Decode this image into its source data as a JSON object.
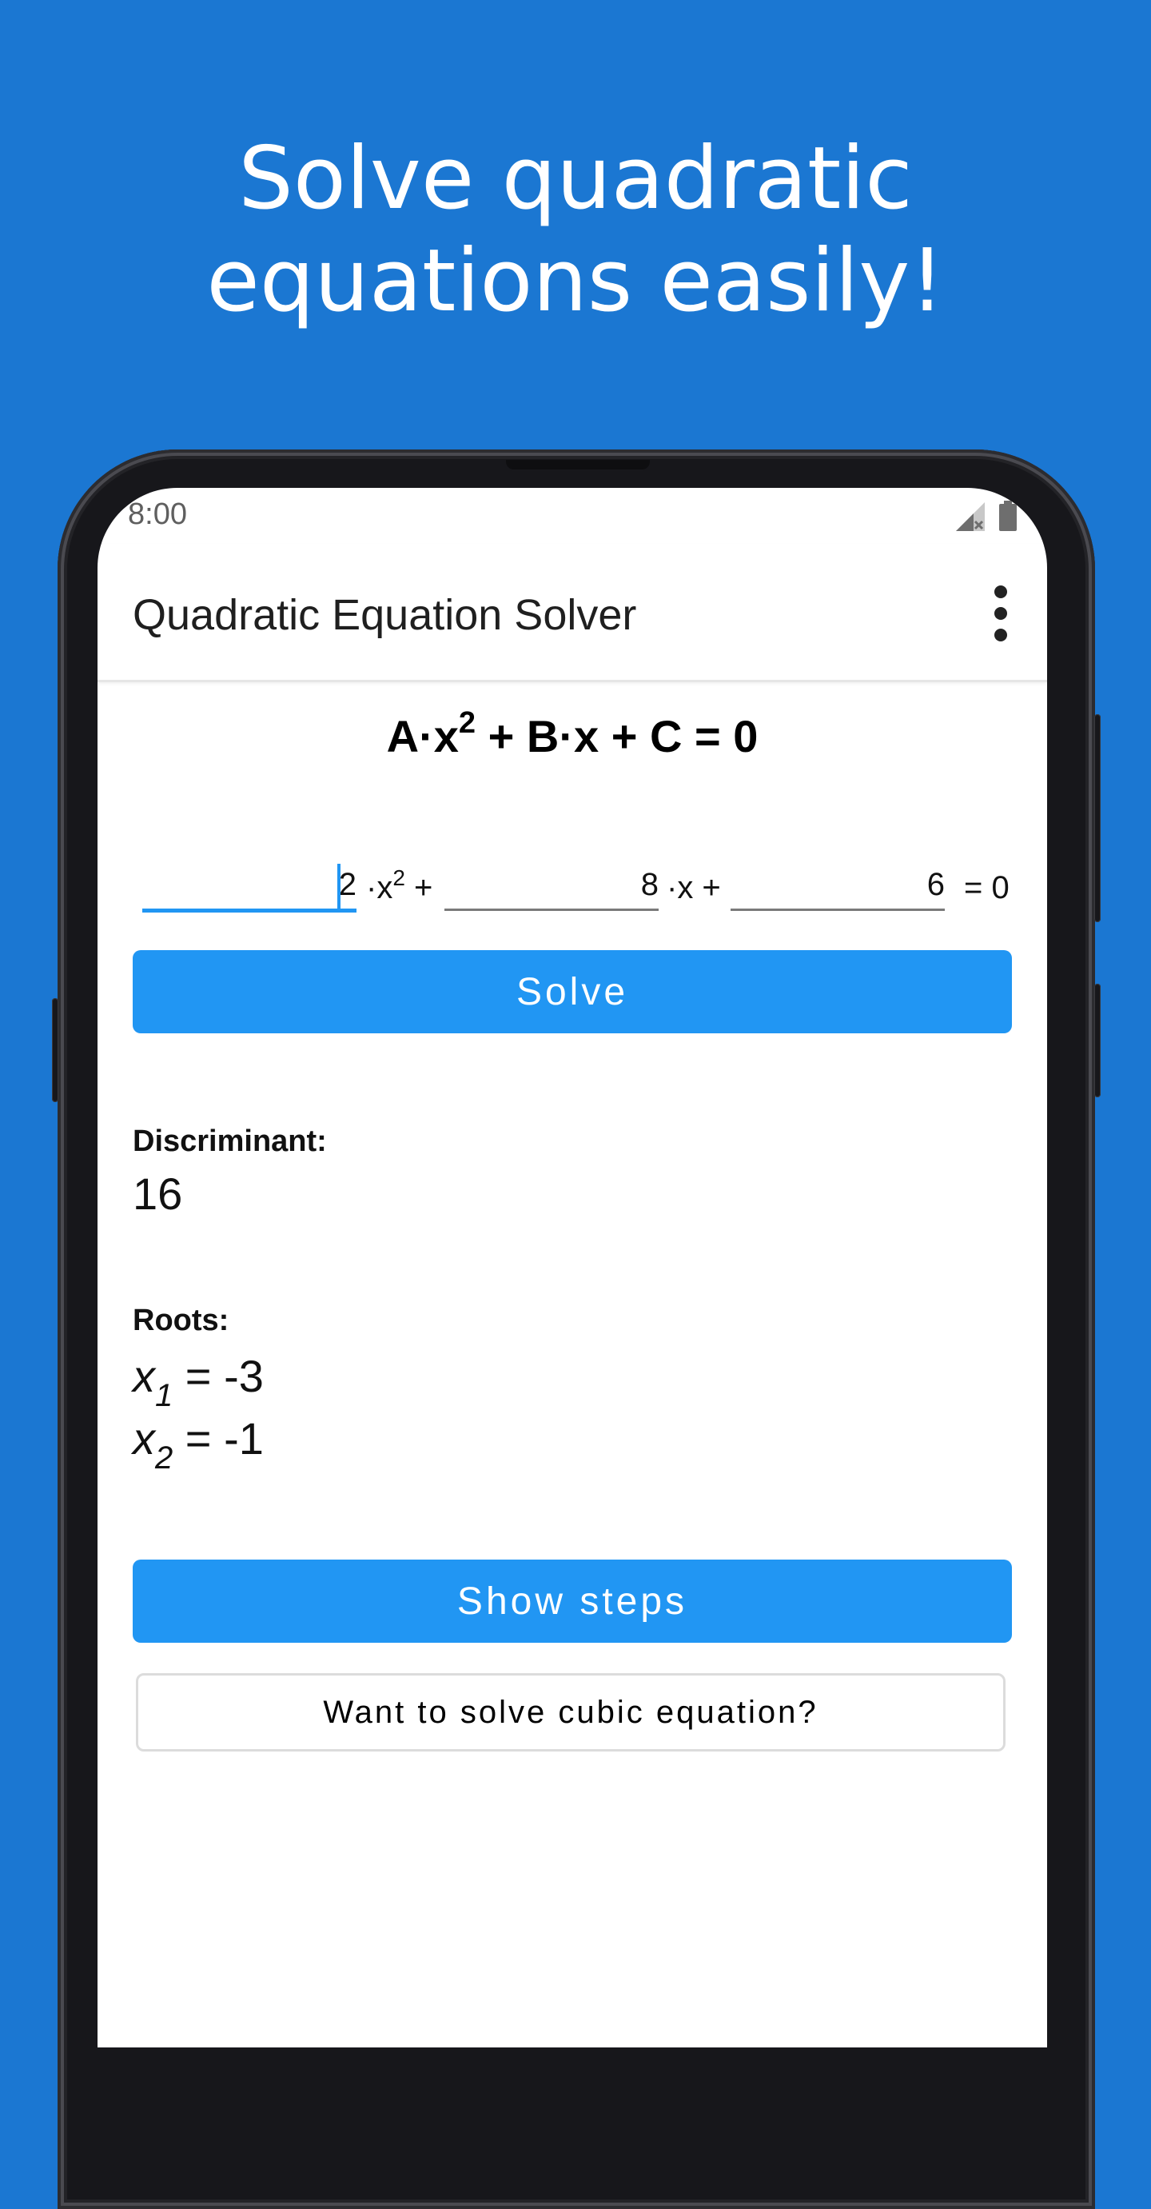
{
  "promo": {
    "headline_line1": "Solve quadratic",
    "headline_line2": "equations easily!"
  },
  "colors": {
    "background": "#1b77d2",
    "accent": "#2196f3",
    "phone_frame": "#17171b"
  },
  "status_bar": {
    "time": "8:00",
    "icons": [
      "signal-no-service-icon",
      "battery-icon"
    ]
  },
  "app_bar": {
    "title": "Quadratic Equation Solver",
    "menu_icon": "more-vert-icon"
  },
  "equation": {
    "coef_a": "A",
    "dot": "·",
    "var_x": "x",
    "exponent": "2",
    "plus": "+",
    "coef_b": "B",
    "coef_c": "C",
    "equals_zero": "= 0"
  },
  "inputs": {
    "a_value": "2",
    "a_suffix": "·x",
    "a_exponent": "2",
    "a_plus": "+",
    "b_value": "8",
    "b_suffix": "·x +",
    "c_value": "6",
    "c_suffix": "= 0",
    "focused_field": "a"
  },
  "buttons": {
    "solve": "Solve",
    "show_steps": "Show steps",
    "cubic": "Want to solve cubic equation?"
  },
  "results": {
    "discriminant_label": "Discriminant:",
    "discriminant_value": "16",
    "roots_label": "Roots:",
    "roots": [
      {
        "var": "x",
        "index": "1",
        "text": " = -3"
      },
      {
        "var": "x",
        "index": "2",
        "text": " = -1"
      }
    ]
  }
}
